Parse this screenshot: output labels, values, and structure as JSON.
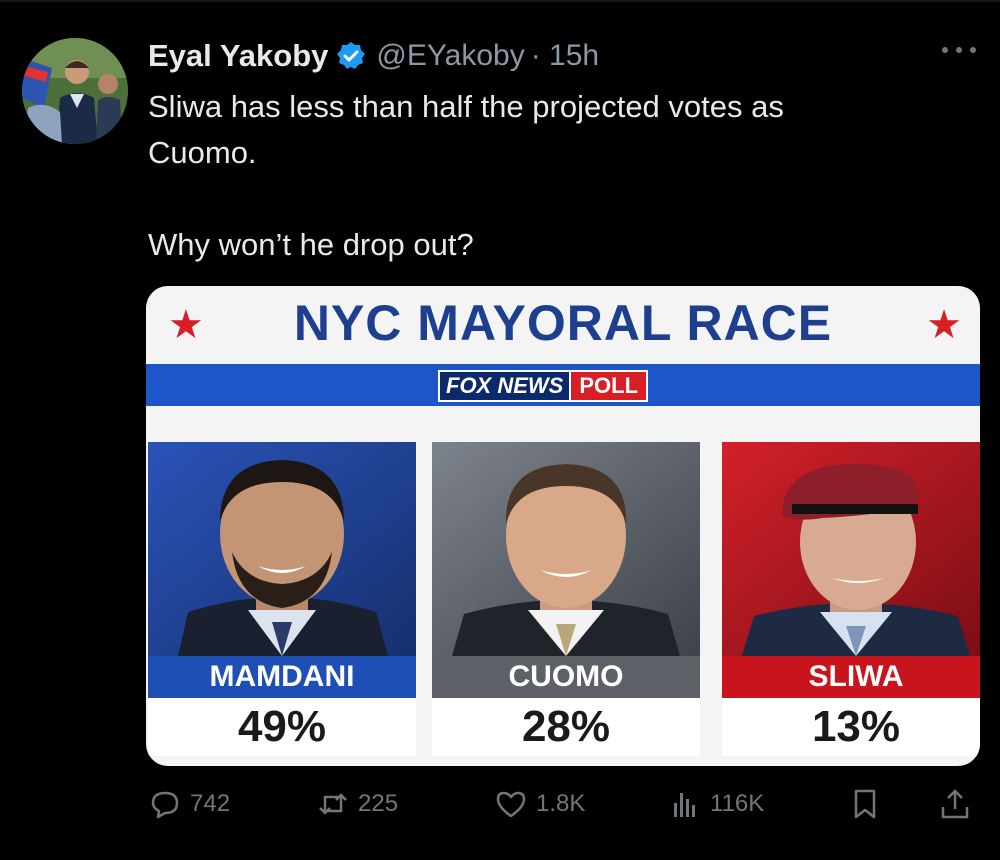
{
  "tweet": {
    "author_name": "Eyal Yakoby",
    "handle": "@EYakoby",
    "time": "· 15h",
    "text_lines": [
      "Sliwa has less than half the projected votes as",
      "Cuomo."
    ],
    "text_line_2": "Why won’t he drop out?"
  },
  "poll_graphic": {
    "title": "NYC MAYORAL RACE",
    "source_brand": "FOX NEWS",
    "source_tag": "POLL",
    "candidates": [
      {
        "name": "MAMDANI",
        "percent": "49%"
      },
      {
        "name": "CUOMO",
        "percent": "28%"
      },
      {
        "name": "SLIWA",
        "percent": "13%"
      }
    ]
  },
  "actions": {
    "replies": "742",
    "reposts": "225",
    "likes": "1.8K",
    "views": "116K"
  },
  "colors": {
    "background": "#000000",
    "text": "#e7e9ea",
    "muted": "#71767b",
    "verified": "#1d9bf0",
    "fox_blue": "#1d56c8",
    "fox_red": "#d81f26"
  }
}
